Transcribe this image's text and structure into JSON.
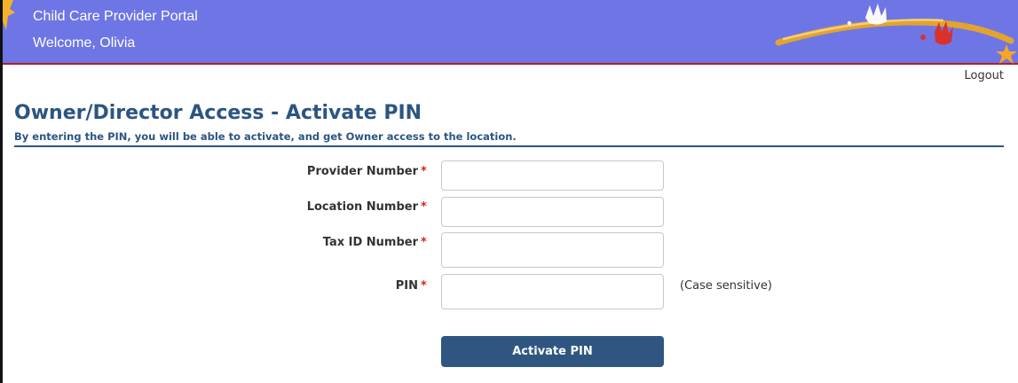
{
  "header": {
    "title": "Child Care Provider Portal",
    "welcome": "Welcome, Olivia",
    "colors": {
      "banner": "#6e76e6",
      "border": "#b31f24"
    }
  },
  "nav": {
    "logout_label": "Logout"
  },
  "page": {
    "title": "Owner/Director Access - Activate PIN",
    "subtitle": "By entering the PIN, you will be able to activate, and get Owner access to the location."
  },
  "form": {
    "required_marker": "*",
    "fields": [
      {
        "label": "Provider Number",
        "value": "",
        "placeholder": ""
      },
      {
        "label": "Location Number",
        "value": "",
        "placeholder": ""
      },
      {
        "label": "Tax ID Number",
        "value": "",
        "placeholder": ""
      },
      {
        "label": "PIN",
        "value": "",
        "placeholder": "",
        "hint": "(Case sensitive)"
      }
    ],
    "submit_label": "Activate PIN"
  },
  "colors": {
    "accent": "#2b5582",
    "button": "#2f5680",
    "required": "#d9251c"
  }
}
